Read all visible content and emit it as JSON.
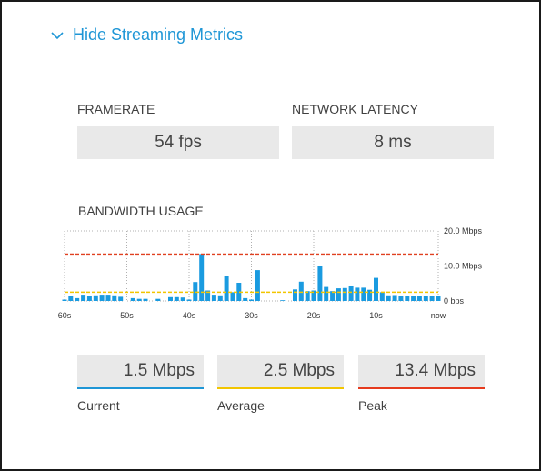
{
  "toggle": {
    "label": "Hide Streaming Metrics"
  },
  "metrics": {
    "framerate": {
      "label": "FRAMERATE",
      "value": "54 fps"
    },
    "latency": {
      "label": "NETWORK LATENCY",
      "value": "8 ms"
    }
  },
  "bandwidth": {
    "label": "BANDWIDTH USAGE"
  },
  "chart_data": {
    "type": "bar",
    "title": "",
    "x_tick_labels": [
      "60s",
      "50s",
      "40s",
      "30s",
      "20s",
      "10s",
      "now"
    ],
    "y_tick_labels": [
      "20.0 Mbps",
      "10.0 Mbps",
      "0 bps"
    ],
    "ylim": [
      0,
      20
    ],
    "xlim": [
      60,
      0
    ],
    "grid": true,
    "series": [
      {
        "unit": "Mbps",
        "x_seconds_ago": [
          60,
          59,
          58,
          57,
          56,
          55,
          54,
          53,
          52,
          51,
          50,
          49,
          48,
          47,
          46,
          45,
          44,
          43,
          42,
          41,
          40,
          39,
          38,
          37,
          36,
          35,
          34,
          33,
          32,
          31,
          30,
          29,
          28,
          27,
          26,
          25,
          24,
          23,
          22,
          21,
          20,
          19,
          18,
          17,
          16,
          15,
          14,
          13,
          12,
          11,
          10,
          9,
          8,
          7,
          6,
          5,
          4,
          3,
          2,
          1,
          0
        ],
        "values": [
          0.4,
          1.5,
          0.8,
          1.8,
          1.5,
          1.6,
          1.8,
          1.8,
          1.6,
          1.2,
          0,
          0.8,
          0.6,
          0.6,
          0,
          0.6,
          0,
          1.1,
          1.1,
          1.0,
          0.4,
          5.4,
          13.4,
          3.0,
          1.8,
          1.6,
          7.2,
          2.5,
          5.2,
          0.8,
          0.4,
          8.8,
          0,
          0,
          0,
          0.2,
          0,
          3.3,
          5.5,
          2.8,
          3.0,
          10.0,
          4.0,
          2.8,
          3.6,
          3.7,
          4.2,
          3.8,
          3.8,
          3.2,
          6.6,
          2.5,
          1.6,
          1.7,
          1.5,
          1.5,
          1.5,
          1.5,
          1.5,
          1.5,
          1.5
        ]
      }
    ],
    "reference_lines": [
      {
        "name": "Peak",
        "value": 13.4,
        "color": "#e04020"
      },
      {
        "name": "Average",
        "value": 2.5,
        "color": "#f2c500"
      }
    ]
  },
  "stats": [
    {
      "key": "current",
      "value": "1.5 Mbps",
      "label": "Current",
      "color": "#1e96d6"
    },
    {
      "key": "average",
      "value": "2.5 Mbps",
      "label": "Average",
      "color": "#f2c500"
    },
    {
      "key": "peak",
      "value": "13.4 Mbps",
      "label": "Peak",
      "color": "#e63b1e"
    }
  ],
  "colors": {
    "accent": "#1e96d6",
    "bar": "#1a9be0",
    "grid": "#b0b0b0"
  }
}
